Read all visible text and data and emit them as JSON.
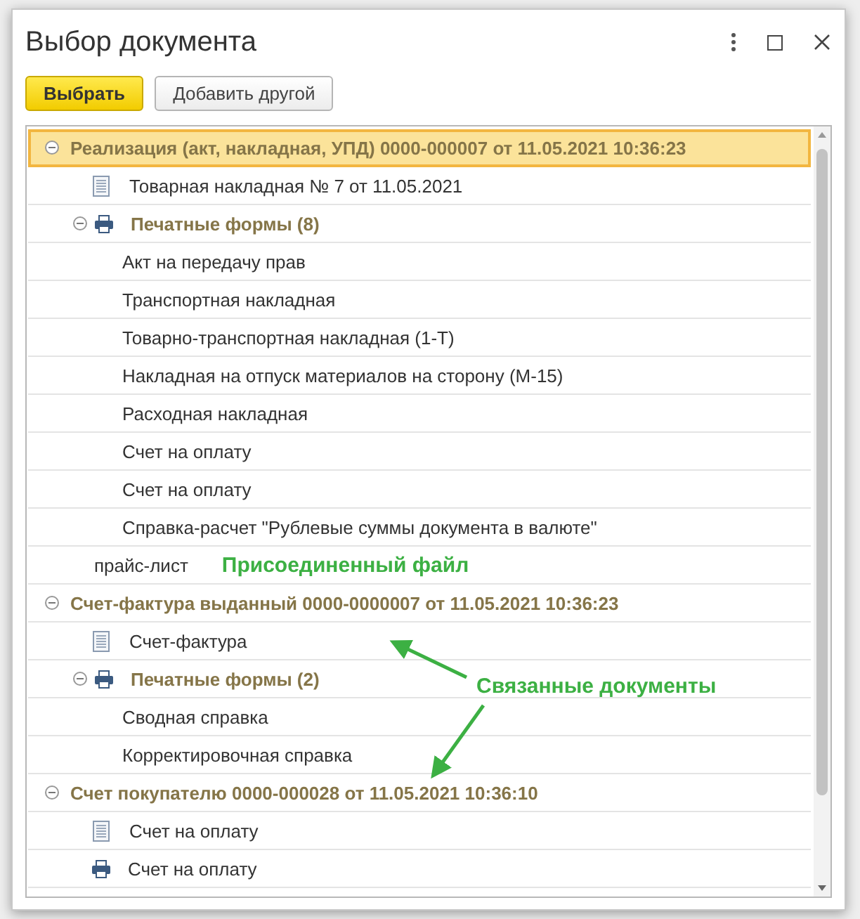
{
  "window": {
    "title": "Выбор документа"
  },
  "buttons": [
    {
      "label": "Выбрать",
      "kind": "primary"
    },
    {
      "label": "Добавить другой",
      "kind": "secondary"
    }
  ],
  "tree": [
    {
      "label": "Реализация (акт, накладная, УПД) 0000-000007 от 11.05.2021 10:36:23",
      "kind": "group",
      "selected": true,
      "expanded": true,
      "children": [
        {
          "label": "Товарная накладная № 7 от 11.05.2021",
          "kind": "document"
        },
        {
          "label": "Печатные формы (8)",
          "kind": "print_forms",
          "expanded": true,
          "children": [
            {
              "label": "Акт на передачу прав",
              "kind": "form"
            },
            {
              "label": "Транспортная накладная",
              "kind": "form"
            },
            {
              "label": "Товарно-транспортная накладная (1-Т)",
              "kind": "form"
            },
            {
              "label": "Накладная на отпуск материалов на сторону (М-15)",
              "kind": "form"
            },
            {
              "label": "Расходная накладная",
              "kind": "form"
            },
            {
              "label": "Счет на оплату",
              "kind": "form"
            },
            {
              "label": "Счет на оплату",
              "kind": "form"
            },
            {
              "label": "Справка-расчет \"Рублевые суммы документа в валюте\"",
              "kind": "form"
            }
          ]
        },
        {
          "label": "прайс-лист",
          "kind": "file",
          "note": "Присоединенный файл"
        }
      ]
    },
    {
      "label": "Счет-фактура выданный 0000-0000007 от 11.05.2021 10:36:23",
      "kind": "group",
      "selected": false,
      "expanded": true,
      "children": [
        {
          "label": "Счет-фактура",
          "kind": "document"
        },
        {
          "label": "Печатные формы (2)",
          "kind": "print_forms",
          "expanded": true,
          "children": [
            {
              "label": "Сводная справка",
              "kind": "form"
            },
            {
              "label": "Корректировочная справка",
              "kind": "form"
            }
          ]
        }
      ]
    },
    {
      "label": "Счет покупателю 0000-000028 от 11.05.2021 10:36:10",
      "kind": "group",
      "selected": false,
      "expanded": true,
      "children": [
        {
          "label": "Счет на оплату",
          "kind": "document"
        },
        {
          "label": "Счет на оплату",
          "kind": "printed"
        }
      ]
    }
  ],
  "callout": {
    "text": "Связанные документы"
  }
}
